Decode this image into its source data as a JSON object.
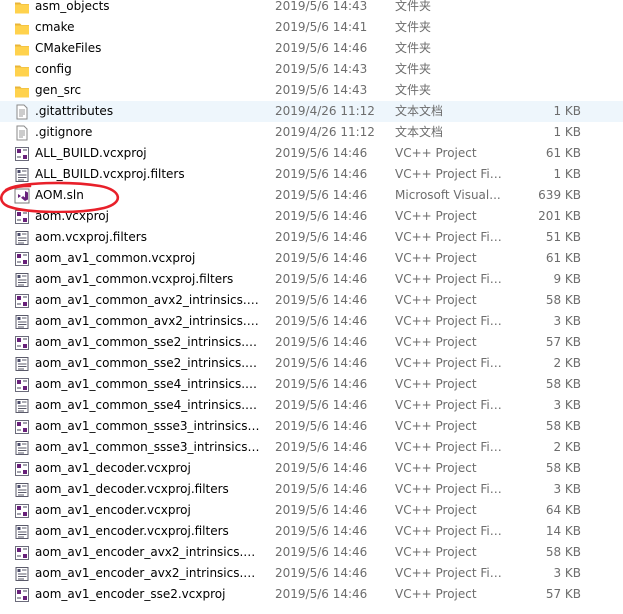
{
  "files": [
    {
      "name": "asm_objects",
      "date": "2019/5/6 14:43",
      "type": "文件夹",
      "size": "",
      "icon": "folder-icon"
    },
    {
      "name": "cmake",
      "date": "2019/5/6 14:41",
      "type": "文件夹",
      "size": "",
      "icon": "folder-icon"
    },
    {
      "name": "CMakeFiles",
      "date": "2019/5/6 14:46",
      "type": "文件夹",
      "size": "",
      "icon": "folder-icon"
    },
    {
      "name": "config",
      "date": "2019/5/6 14:43",
      "type": "文件夹",
      "size": "",
      "icon": "folder-icon"
    },
    {
      "name": "gen_src",
      "date": "2019/5/6 14:43",
      "type": "文件夹",
      "size": "",
      "icon": "folder-icon"
    },
    {
      "name": ".gitattributes",
      "date": "2019/4/26 11:12",
      "type": "文本文档",
      "size": "1 KB",
      "icon": "text-file-icon"
    },
    {
      "name": ".gitignore",
      "date": "2019/4/26 11:12",
      "type": "文本文档",
      "size": "1 KB",
      "icon": "text-file-icon"
    },
    {
      "name": "ALL_BUILD.vcxproj",
      "date": "2019/5/6 14:46",
      "type": "VC++ Project",
      "size": "61 KB",
      "icon": "vcxproj-icon"
    },
    {
      "name": "ALL_BUILD.vcxproj.filters",
      "date": "2019/5/6 14:46",
      "type": "VC++ Project Fil...",
      "size": "1 KB",
      "icon": "vcxproj-filters-icon"
    },
    {
      "name": "AOM.sln",
      "date": "2019/5/6 14:46",
      "type": "Microsoft Visual...",
      "size": "639 KB",
      "icon": "visual-studio-solution-icon"
    },
    {
      "name": "aom.vcxproj",
      "date": "2019/5/6 14:46",
      "type": "VC++ Project",
      "size": "201 KB",
      "icon": "vcxproj-icon"
    },
    {
      "name": "aom.vcxproj.filters",
      "date": "2019/5/6 14:46",
      "type": "VC++ Project Fil...",
      "size": "51 KB",
      "icon": "vcxproj-filters-icon"
    },
    {
      "name": "aom_av1_common.vcxproj",
      "date": "2019/5/6 14:46",
      "type": "VC++ Project",
      "size": "61 KB",
      "icon": "vcxproj-icon"
    },
    {
      "name": "aom_av1_common.vcxproj.filters",
      "date": "2019/5/6 14:46",
      "type": "VC++ Project Fil...",
      "size": "9 KB",
      "icon": "vcxproj-filters-icon"
    },
    {
      "name": "aom_av1_common_avx2_intrinsics.vcx...",
      "date": "2019/5/6 14:46",
      "type": "VC++ Project",
      "size": "58 KB",
      "icon": "vcxproj-icon"
    },
    {
      "name": "aom_av1_common_avx2_intrinsics.vcx...",
      "date": "2019/5/6 14:46",
      "type": "VC++ Project Fil...",
      "size": "3 KB",
      "icon": "vcxproj-filters-icon"
    },
    {
      "name": "aom_av1_common_sse2_intrinsics.vcx...",
      "date": "2019/5/6 14:46",
      "type": "VC++ Project",
      "size": "57 KB",
      "icon": "vcxproj-icon"
    },
    {
      "name": "aom_av1_common_sse2_intrinsics.vcx...",
      "date": "2019/5/6 14:46",
      "type": "VC++ Project Fil...",
      "size": "2 KB",
      "icon": "vcxproj-filters-icon"
    },
    {
      "name": "aom_av1_common_sse4_intrinsics.vcx...",
      "date": "2019/5/6 14:46",
      "type": "VC++ Project",
      "size": "58 KB",
      "icon": "vcxproj-icon"
    },
    {
      "name": "aom_av1_common_sse4_intrinsics.vcx...",
      "date": "2019/5/6 14:46",
      "type": "VC++ Project Fil...",
      "size": "3 KB",
      "icon": "vcxproj-filters-icon"
    },
    {
      "name": "aom_av1_common_ssse3_intrinsics.vc...",
      "date": "2019/5/6 14:46",
      "type": "VC++ Project",
      "size": "58 KB",
      "icon": "vcxproj-icon"
    },
    {
      "name": "aom_av1_common_ssse3_intrinsics.vc...",
      "date": "2019/5/6 14:46",
      "type": "VC++ Project Fil...",
      "size": "2 KB",
      "icon": "vcxproj-filters-icon"
    },
    {
      "name": "aom_av1_decoder.vcxproj",
      "date": "2019/5/6 14:46",
      "type": "VC++ Project",
      "size": "58 KB",
      "icon": "vcxproj-icon"
    },
    {
      "name": "aom_av1_decoder.vcxproj.filters",
      "date": "2019/5/6 14:46",
      "type": "VC++ Project Fil...",
      "size": "3 KB",
      "icon": "vcxproj-filters-icon"
    },
    {
      "name": "aom_av1_encoder.vcxproj",
      "date": "2019/5/6 14:46",
      "type": "VC++ Project",
      "size": "64 KB",
      "icon": "vcxproj-icon"
    },
    {
      "name": "aom_av1_encoder.vcxproj.filters",
      "date": "2019/5/6 14:46",
      "type": "VC++ Project Fil...",
      "size": "14 KB",
      "icon": "vcxproj-filters-icon"
    },
    {
      "name": "aom_av1_encoder_avx2_intrinsics.vcx...",
      "date": "2019/5/6 14:46",
      "type": "VC++ Project",
      "size": "58 KB",
      "icon": "vcxproj-icon"
    },
    {
      "name": "aom_av1_encoder_avx2_intrinsics.vcx...",
      "date": "2019/5/6 14:46",
      "type": "VC++ Project Fil...",
      "size": "3 KB",
      "icon": "vcxproj-filters-icon"
    },
    {
      "name": "aom_av1_encoder_sse2.vcxproj",
      "date": "2019/5/6 14:46",
      "type": "VC++ Project",
      "size": "57 KB",
      "icon": "vcxproj-icon"
    }
  ],
  "selected_index": 5,
  "highlighted_file": "AOM.sln",
  "colors": {
    "folder": "#ffd24d",
    "selection": "#eef6fc",
    "annotation": "#e8202a",
    "vs_purple": "#68217a"
  }
}
